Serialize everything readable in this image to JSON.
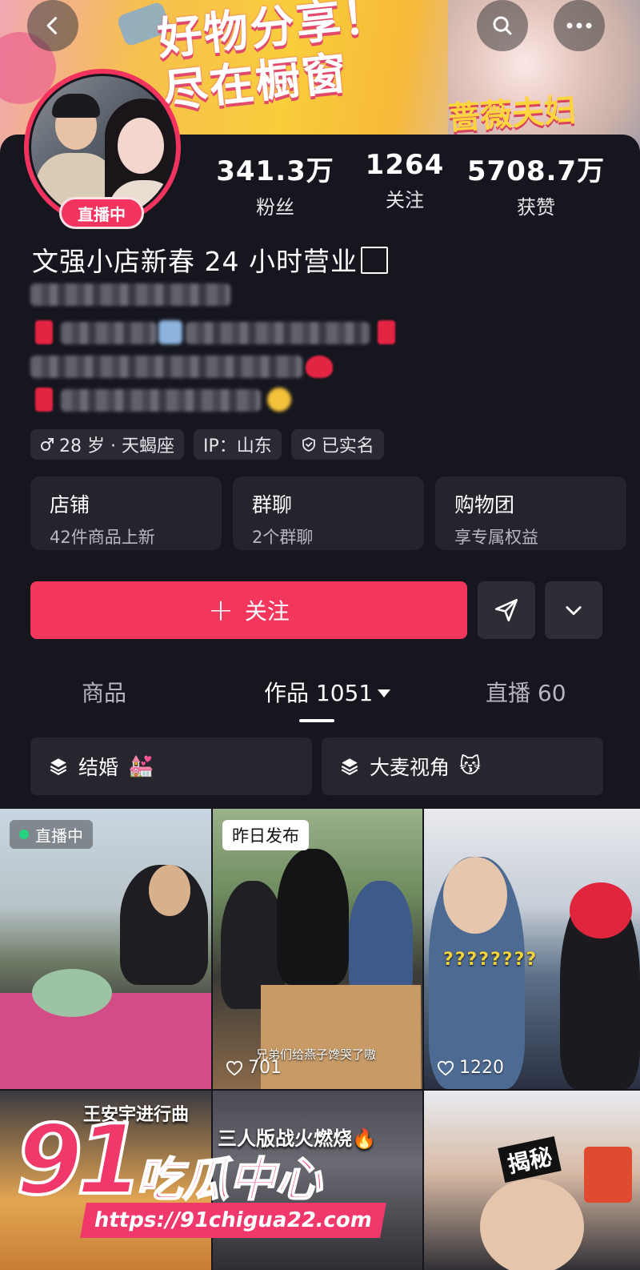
{
  "banner": {
    "headline_line1": "好物分享！",
    "headline_line2": "尽在橱窗",
    "brand": "蔷薇夫妇"
  },
  "topbar": {
    "back_icon": "chevron-left-icon",
    "search_icon": "search-icon",
    "more_icon": "more-horizontal-icon"
  },
  "profile": {
    "live_badge": "直播中",
    "name": "文强小店新春 24 小时营业",
    "stats": [
      {
        "value": "341.3万",
        "label": "粉丝"
      },
      {
        "value": "1264",
        "label": "关注"
      },
      {
        "value": "5708.7万",
        "label": "获赞"
      }
    ],
    "tags": [
      {
        "icon": "male-icon",
        "text": "28 岁 · 天蝎座"
      },
      {
        "icon": "",
        "text": "IP：山东"
      },
      {
        "icon": "verified-shield-icon",
        "text": "已实名"
      }
    ]
  },
  "cards": [
    {
      "title": "店铺",
      "subtitle": "42件商品上新"
    },
    {
      "title": "群聊",
      "subtitle": "2个群聊"
    },
    {
      "title": "购物团",
      "subtitle": "享专属权益"
    }
  ],
  "actions": {
    "follow_label": "关注",
    "share_icon": "send-icon",
    "dropdown_icon": "chevron-down-icon"
  },
  "tabs": [
    {
      "label": "商品"
    },
    {
      "label": "作品 1051"
    },
    {
      "label": "直播 60"
    }
  ],
  "collections": [
    {
      "icon": "layers-icon",
      "label": "结婚",
      "emoji": "💒"
    },
    {
      "icon": "layers-icon",
      "label": "大麦视角",
      "emoji": "😽"
    }
  ],
  "videos": [
    {
      "badge": "直播中",
      "likes": ""
    },
    {
      "badge": "昨日发布",
      "caption": "兄弟们给燕子馋哭了嗷",
      "likes": "701"
    },
    {
      "overlay": "????????",
      "likes": "1220"
    },
    {
      "title": "王安宇进行曲",
      "likes": ""
    },
    {
      "title": "三人版战火燃烧🔥",
      "likes": ""
    },
    {
      "title": "揭秘",
      "likes": ""
    }
  ],
  "watermark": {
    "number": "91",
    "text": "吃瓜中心",
    "url": "https://91chigua22.com"
  },
  "colors": {
    "accent": "#f2365c",
    "background": "#16161e",
    "card": "#24242c"
  }
}
